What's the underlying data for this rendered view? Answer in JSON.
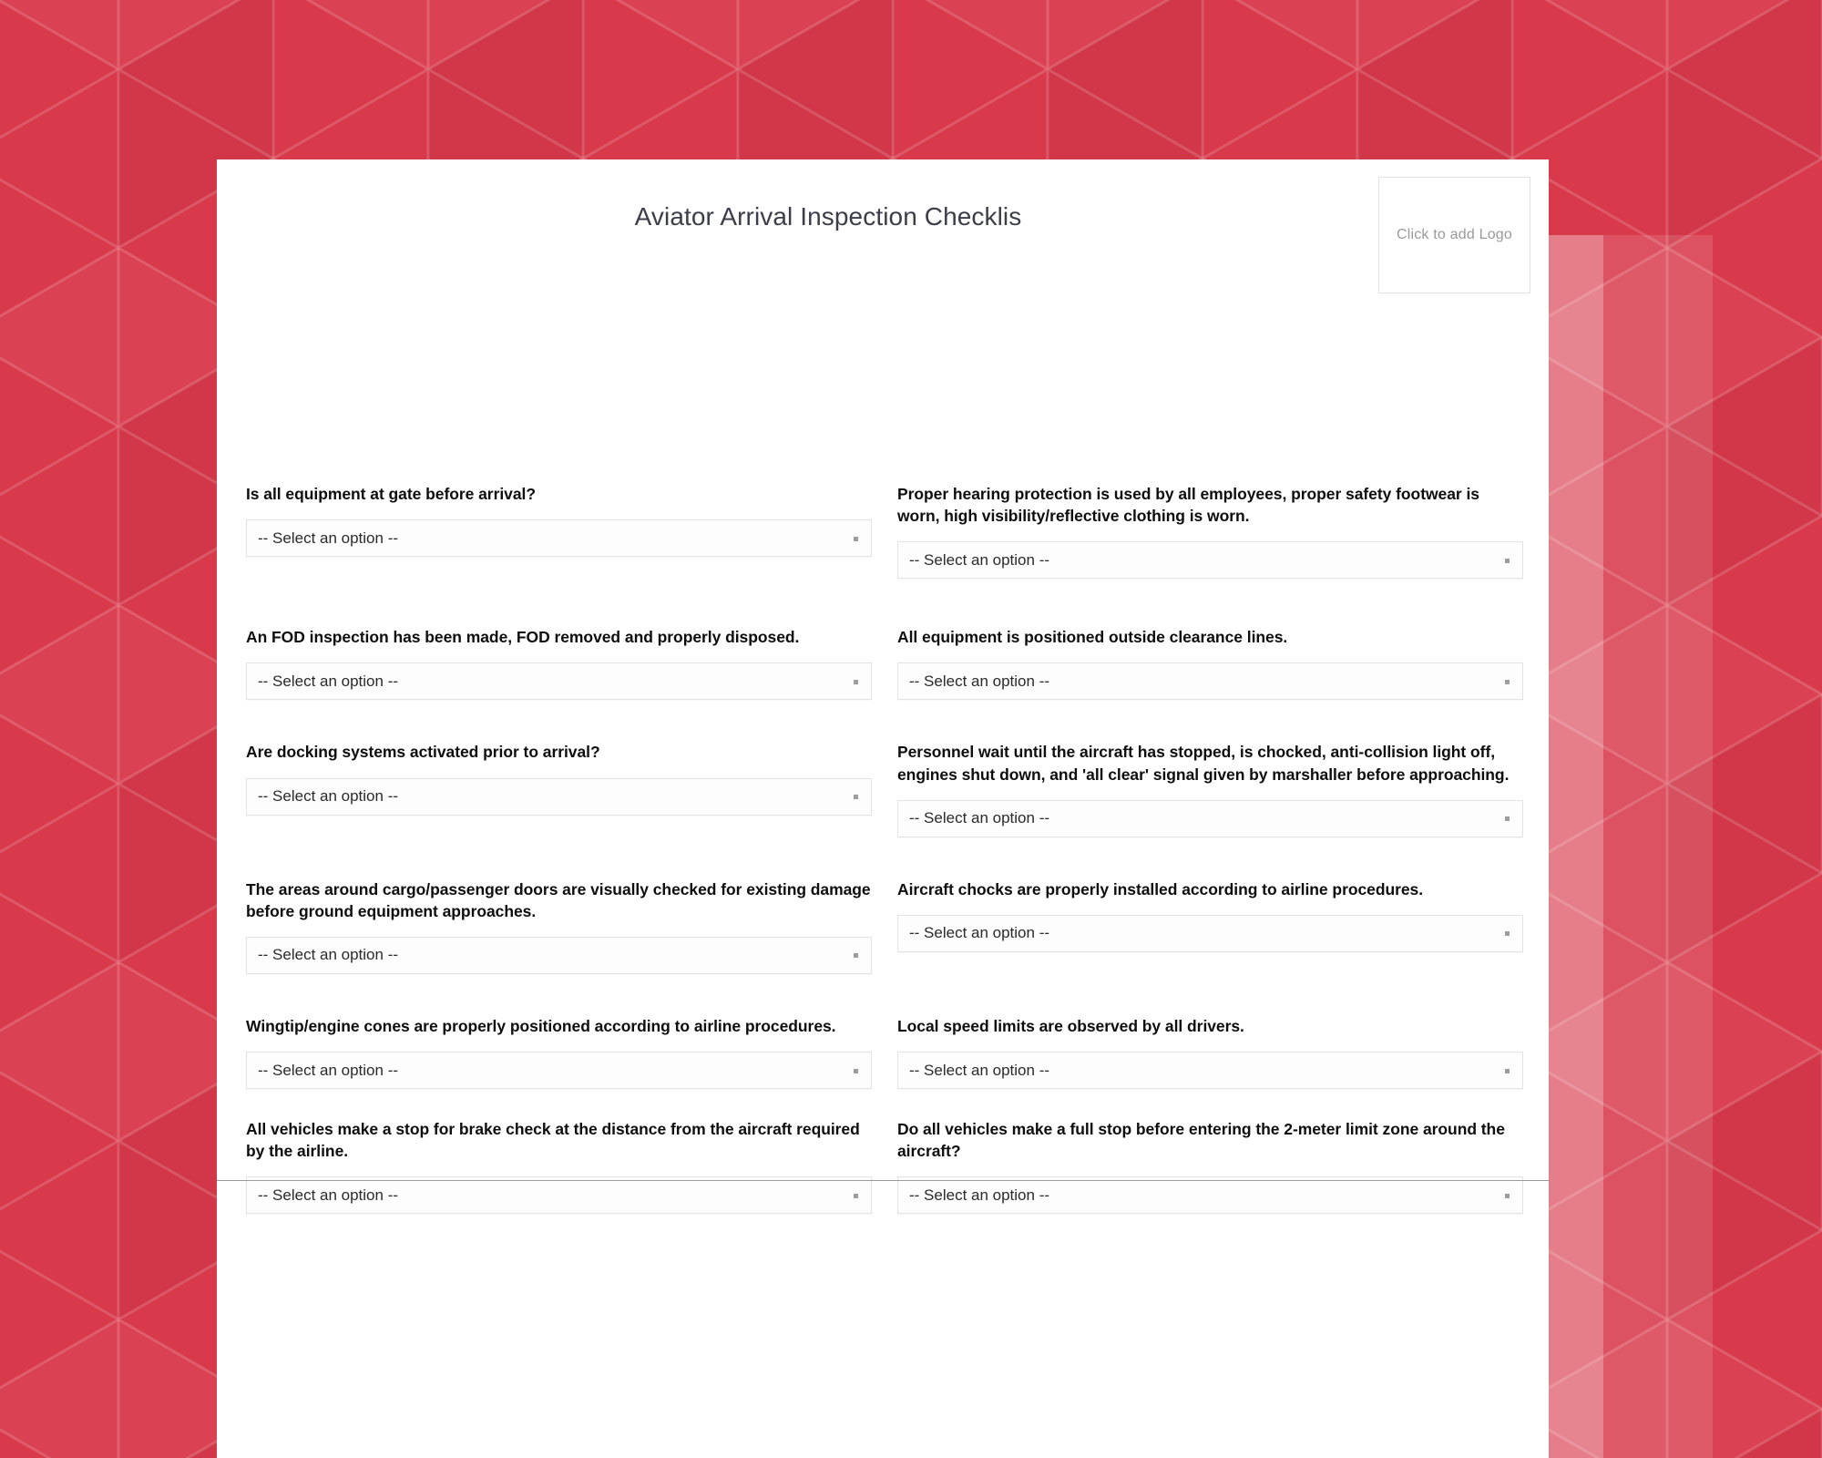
{
  "header": {
    "title": "Aviator Arrival Inspection Checklis",
    "logo_placeholder": "Click to add Logo"
  },
  "colors": {
    "background_red": "#d8394b",
    "background_red_light": "#e8808d",
    "card_background": "#ffffff",
    "title_text": "#3d3d4a",
    "question_text": "#0e0e0e",
    "select_border": "#e3e3e3",
    "placeholder_text": "#9a9a9a"
  },
  "form": {
    "select_placeholder": "-- Select an option --",
    "rows": [
      {
        "left": {
          "question": "Is all equipment at gate before arrival?",
          "value": "-- Select an option --"
        },
        "right": {
          "question": "Proper hearing protection is used by all employees, proper safety footwear is worn, high visibility/reflective clothing is worn.",
          "value": "-- Select an option --"
        }
      },
      {
        "left": {
          "question": "An FOD inspection has been made, FOD removed and properly disposed.",
          "value": "-- Select an option --"
        },
        "right": {
          "question": "All equipment is positioned outside clearance lines.",
          "value": "-- Select an option --"
        }
      },
      {
        "left": {
          "question": "Are docking systems activated prior to arrival?",
          "value": "-- Select an option --"
        },
        "right": {
          "question": "Personnel wait until the aircraft has stopped, is chocked, anti-collision light off, engines shut down, and 'all clear' signal given by marshaller before approaching.",
          "value": "-- Select an option --"
        }
      },
      {
        "left": {
          "question": "The areas around cargo/passenger doors are visually checked for existing damage before ground equipment approaches.",
          "value": "-- Select an option --"
        },
        "right": {
          "question": "Aircraft chocks are properly installed according to airline procedures.",
          "value": "-- Select an option --"
        }
      },
      {
        "left": {
          "question": "Wingtip/engine cones are properly positioned according to airline procedures.",
          "value": "-- Select an option --"
        },
        "right": {
          "question": "Local speed limits are observed by all drivers.",
          "value": "-- Select an option --"
        }
      },
      {
        "left": {
          "question": "All vehicles make a stop for brake check at the distance from the aircraft required by the airline.",
          "value": "-- Select an option --"
        },
        "right": {
          "question": "Do all vehicles make a full stop before entering the 2-meter limit zone around the aircraft?",
          "value": "-- Select an option --"
        }
      }
    ]
  }
}
